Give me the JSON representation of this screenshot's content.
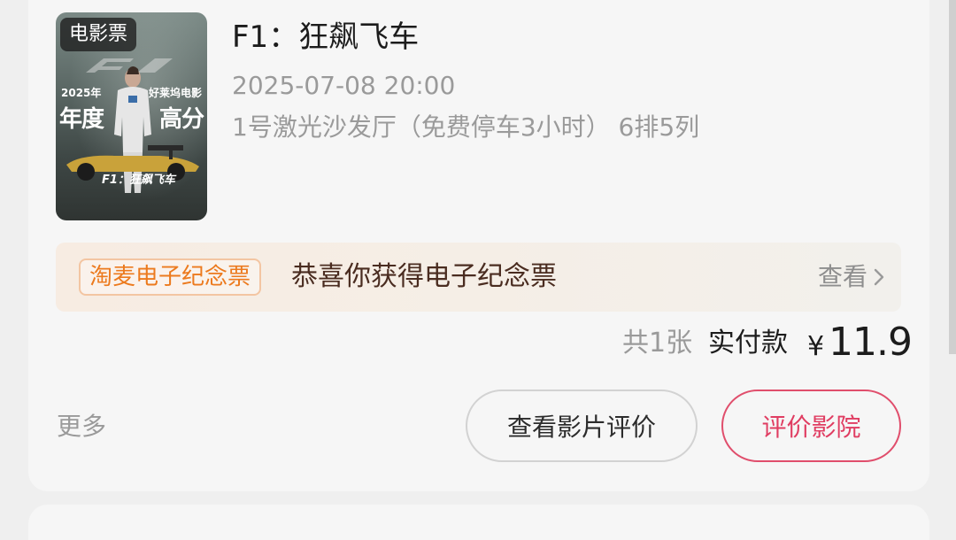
{
  "order": {
    "poster": {
      "tag": "电影票",
      "year_text": "2025年",
      "annual_text": "年度",
      "hollywood_text": "好莱坞电影",
      "high_score_text": "高分",
      "logo_text": "F1：狂飙飞车"
    },
    "movie_title": "F1：狂飙飞车",
    "datetime": "2025-07-08 20:00",
    "hall_seat": "1号激光沙发厅（免费停车3小时） 6排5列",
    "banner": {
      "badge": "淘麦电子纪念票",
      "message": "恭喜你获得电子纪念票",
      "view_label": "查看"
    },
    "ticket_count": "共1张",
    "paid_label": "实付款",
    "currency": "¥",
    "price": "11.9",
    "more_label": "更多",
    "review_film_label": "查看影片评价",
    "review_cinema_label": "评价影院"
  },
  "colors": {
    "accent": "#e03d62",
    "badge_orange": "#ec7a1e",
    "muted_text": "#9a9a9a",
    "card_bg": "#f6f6f6"
  },
  "icons": {
    "banner_arrow": "chevron-right-icon"
  }
}
